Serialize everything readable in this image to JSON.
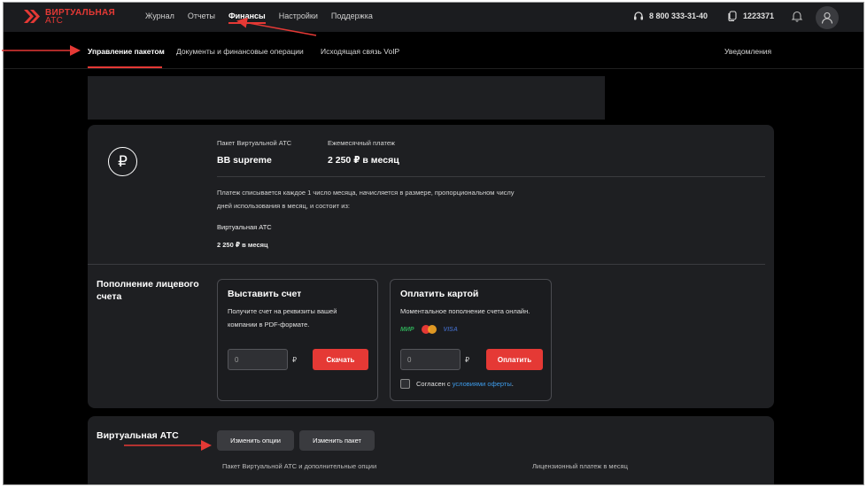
{
  "logo": {
    "line1": "ВИРТУАЛЬНАЯ",
    "line2": "АТС"
  },
  "nav": {
    "items": [
      {
        "label": "Журнал",
        "active": false
      },
      {
        "label": "Отчеты",
        "active": false
      },
      {
        "label": "Финансы",
        "active": true
      },
      {
        "label": "Настройки",
        "active": false
      },
      {
        "label": "Поддержка",
        "active": false
      }
    ],
    "phone": "8 800 333-31-40",
    "account": "1223371"
  },
  "subnav": {
    "tabs": [
      {
        "label": "Управление пакетом",
        "active": true
      },
      {
        "label": "Документы и финансовые операции",
        "active": false
      },
      {
        "label": "Исходящая связь VoIP",
        "active": false
      }
    ],
    "notifications": "Уведомления"
  },
  "package": {
    "currency_symbol": "₽",
    "package_label": "Пакет Виртуальной АТС",
    "package_name": "BB supreme",
    "monthly_label": "Ежемесячный платеж",
    "monthly_value": "2 250 ₽ в месяц",
    "description_line1": "Платеж списывается каждое 1 число месяца, начисляется в размере, пропорциональном числу",
    "description_line2": "дней использования в месяц, и состоит из:",
    "item_name": "Виртуальная АТС",
    "item_price": "2 250 ₽ в месяц"
  },
  "topup": {
    "title": "Пополнение лицевого счета",
    "invoice": {
      "title": "Выставить счет",
      "text_line1": "Получите счет на реквизиты вашей",
      "text_line2": "компании в PDF-формате.",
      "amount_placeholder": "0",
      "currency": "₽",
      "button": "Скачать"
    },
    "card": {
      "title": "Оплатить картой",
      "text": "Моментальное пополнение счета онлайн.",
      "logos": {
        "mir": "МИР",
        "visa": "VISA"
      },
      "amount_placeholder": "0",
      "currency": "₽",
      "button": "Оплатить",
      "agree_prefix": "Согласен с ",
      "agree_link": "условиями оферты",
      "agree_suffix": ".",
      "checked": false
    }
  },
  "vats": {
    "title": "Виртуальная АТС",
    "change_options": "Изменить опции",
    "change_package": "Изменить пакет",
    "col1": "Пакет Виртуальной АТС и дополнительные опции",
    "col2": "Лицензионный платеж в месяц"
  },
  "colors": {
    "accent": "#e53935",
    "link": "#3d9be9",
    "panel": "#1e1f22",
    "background": "#000000"
  }
}
